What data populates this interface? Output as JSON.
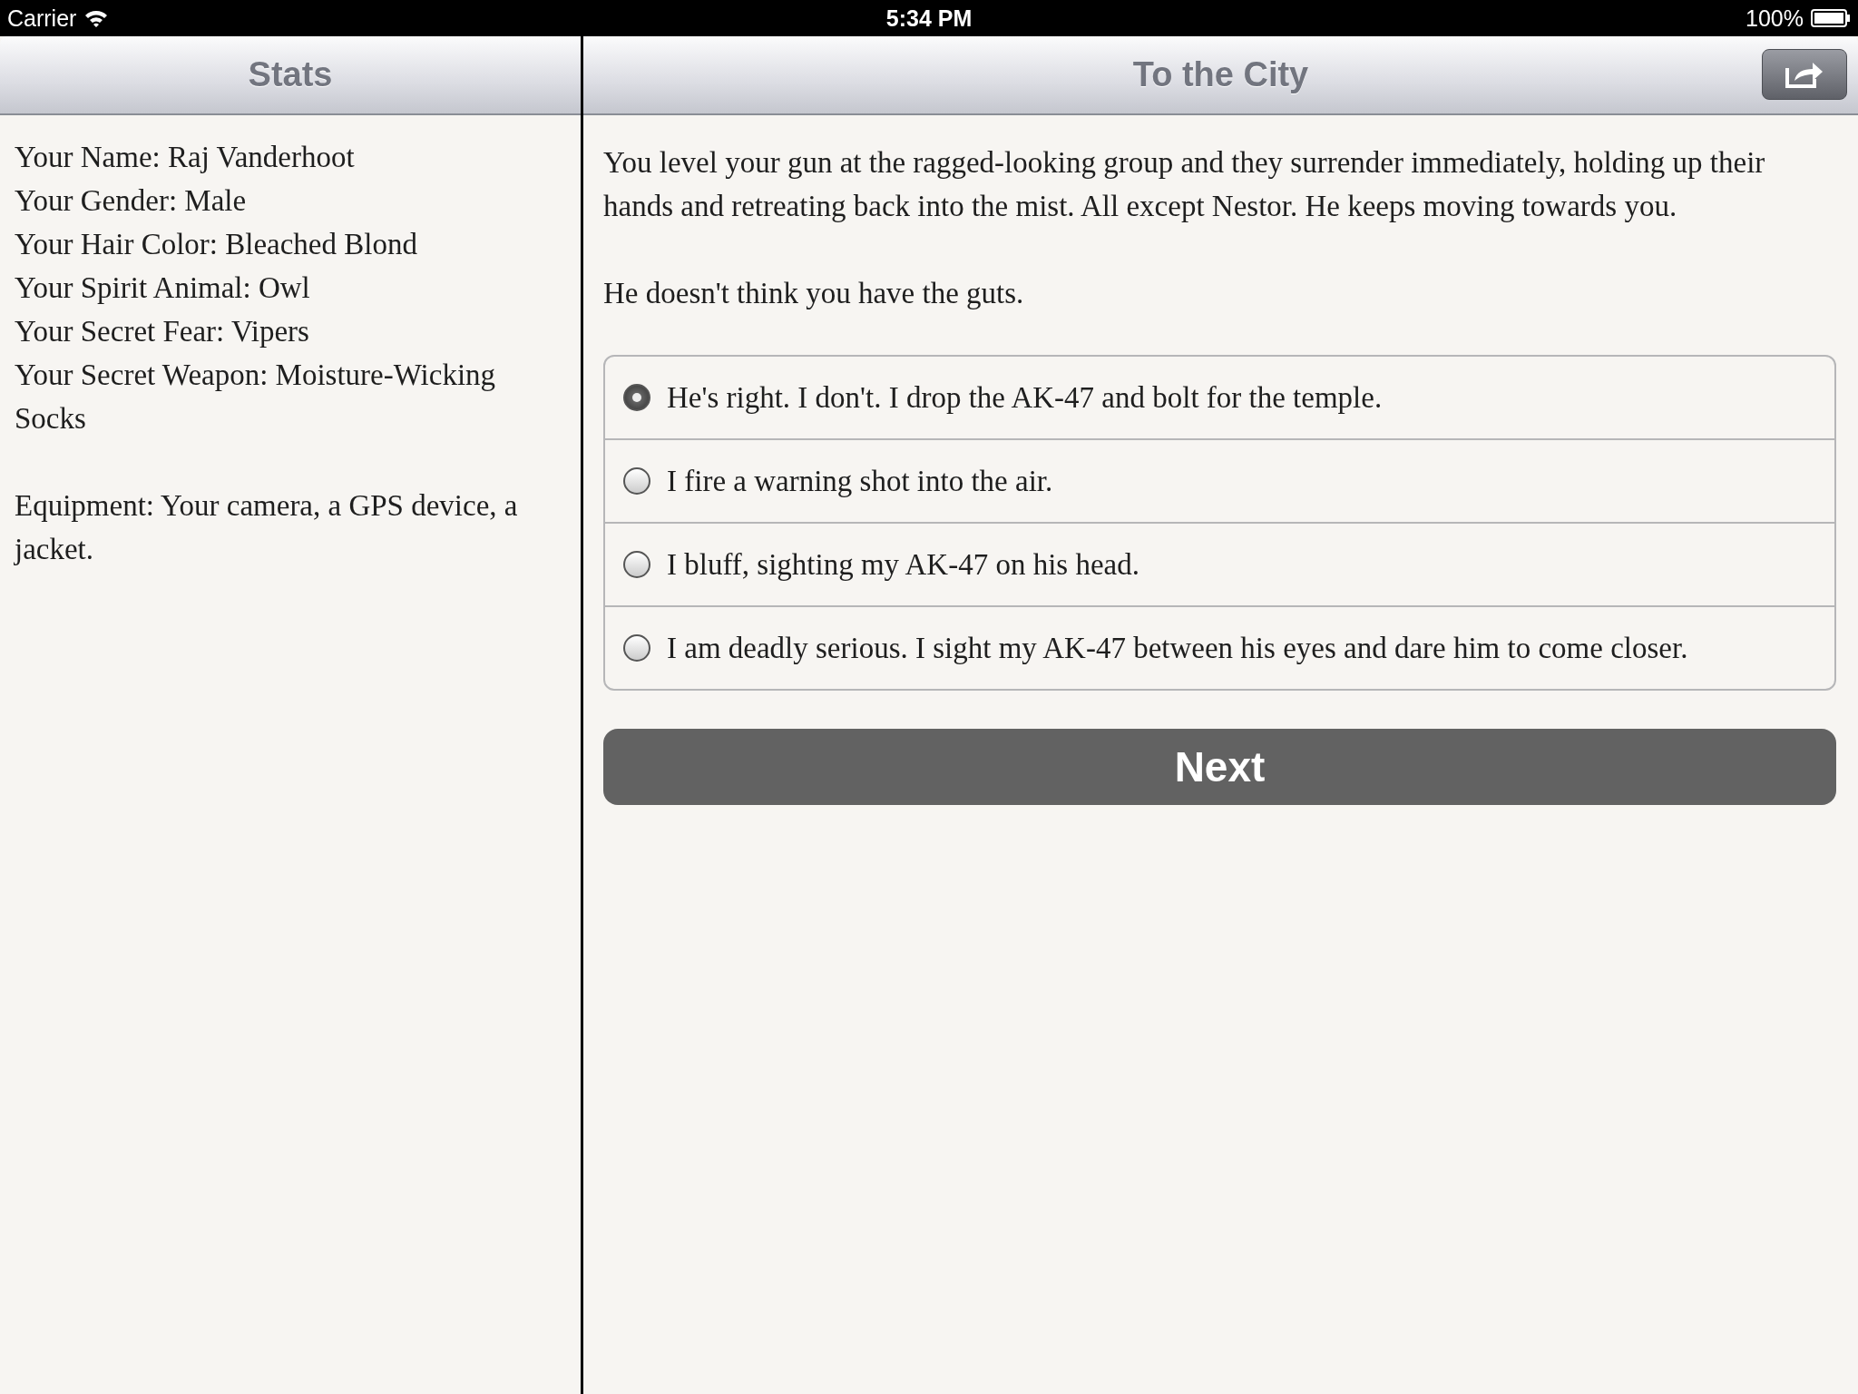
{
  "status_bar": {
    "carrier": "Carrier",
    "time": "5:34 PM",
    "battery": "100%"
  },
  "sidebar": {
    "title": "Stats",
    "lines": [
      "Your Name: Raj Vanderhoot",
      "Your Gender: Male",
      "Your Hair Color: Bleached Blond",
      "Your Spirit Animal: Owl",
      "Your Secret Fear: Vipers",
      "Your Secret Weapon: Moisture-Wicking Socks"
    ],
    "equipment": "Equipment: Your camera, a GPS device, a jacket."
  },
  "main": {
    "title": "To the City",
    "paragraphs": [
      "You level your gun at the ragged-looking group and they surrender immediately, holding up their hands and retreating back into the mist. All except Nestor. He keeps moving towards you.",
      "He doesn't think you have the guts."
    ],
    "choices": [
      {
        "label": "He's right. I don't. I drop the AK-47 and bolt for the temple.",
        "selected": true
      },
      {
        "label": "I fire a warning shot into the air.",
        "selected": false
      },
      {
        "label": "I bluff, sighting my AK-47 on his head.",
        "selected": false
      },
      {
        "label": "I am deadly serious. I sight my AK-47 between his eyes and dare him to come closer.",
        "selected": false
      }
    ],
    "next_button": "Next"
  }
}
